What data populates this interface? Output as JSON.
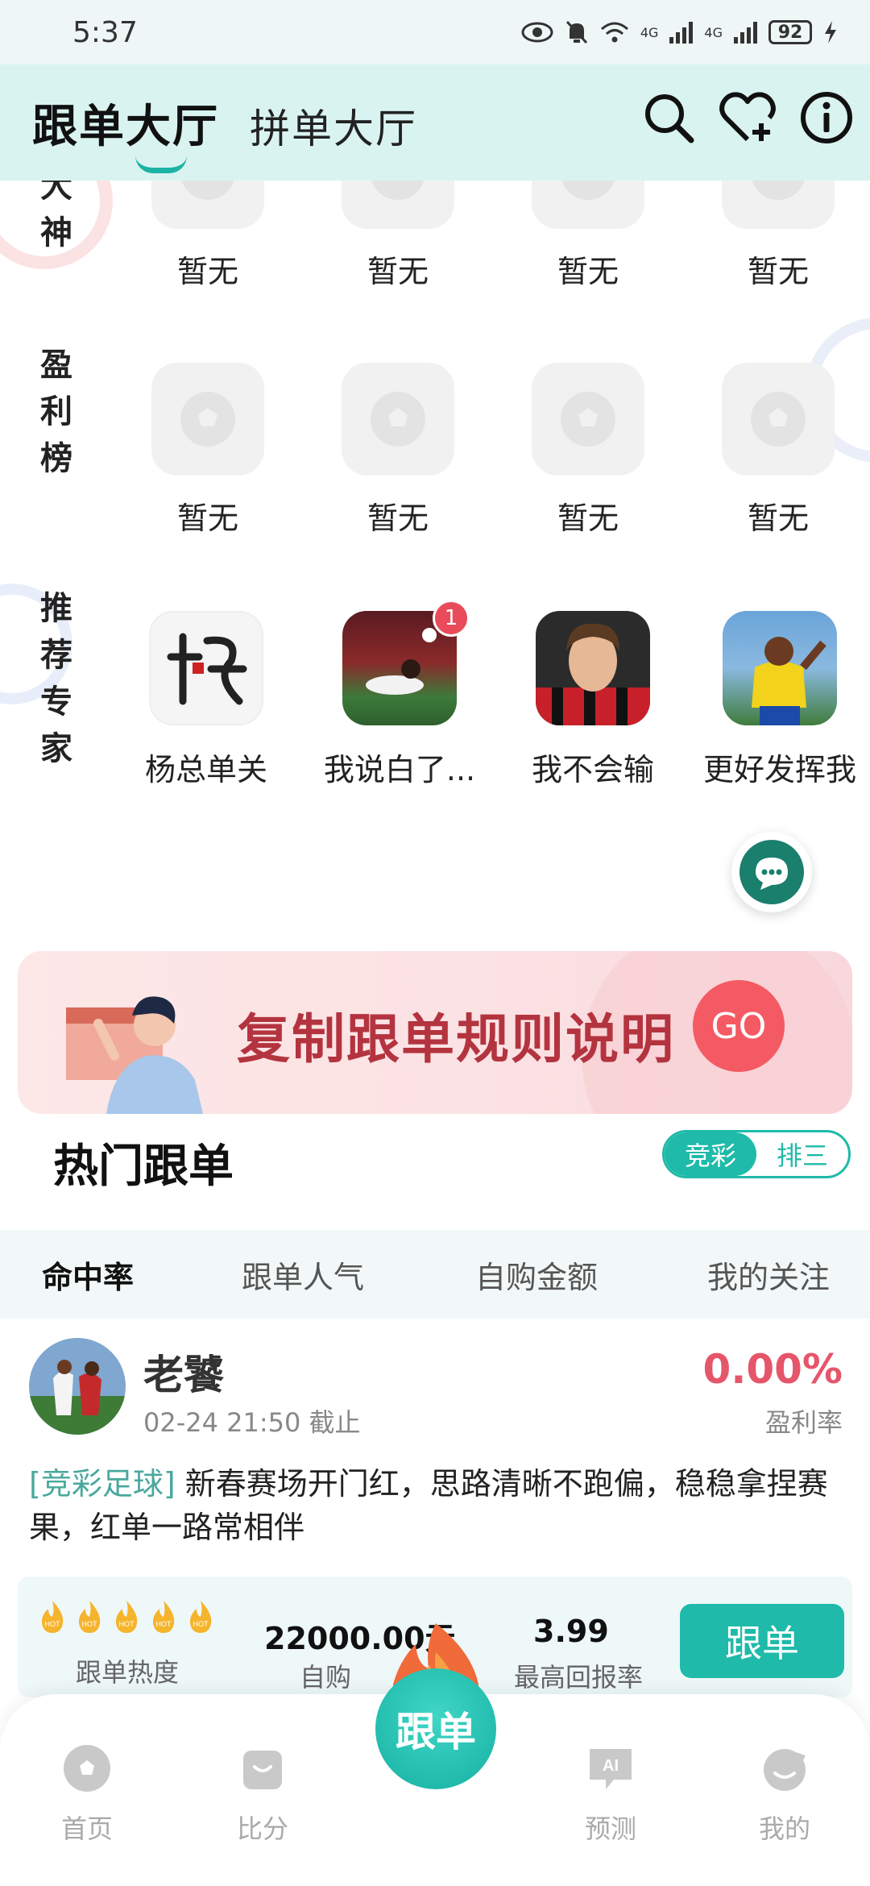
{
  "status_bar": {
    "time": "5:37",
    "battery": "92",
    "net1": "4G",
    "net2": "4G"
  },
  "header": {
    "tab_active": "跟单大厅",
    "tab_other": "拼单大厅"
  },
  "rankings": {
    "row1": {
      "label": "大神",
      "items": [
        "暂无",
        "暂无",
        "暂无",
        "暂无"
      ]
    },
    "row2": {
      "label": "盈利榜",
      "items": [
        "暂无",
        "暂无",
        "暂无",
        "暂无"
      ]
    },
    "experts": {
      "label": "推荐专家",
      "items": [
        {
          "name": "杨总单关"
        },
        {
          "name": "我说白了...",
          "badge": "1"
        },
        {
          "name": "我不会输"
        },
        {
          "name": "更好发挥我"
        }
      ]
    }
  },
  "banner": {
    "text": "复制跟单规则说明",
    "go": "GO"
  },
  "hot": {
    "title": "热门跟单",
    "segment": [
      "竞彩",
      "排三"
    ],
    "sort_tabs": [
      "命中率",
      "跟单人气",
      "自购金额",
      "我的关注"
    ]
  },
  "card": {
    "name": "老饕",
    "time": "02-24 21:50 截止",
    "rate": "0.00%",
    "rate_label": "盈利率",
    "tag": "[竞彩足球]",
    "desc": " 新春赛场开门红，思路清晰不跑偏，稳稳拿捏赛果，红单一路常相伴",
    "heat_label": "跟单热度",
    "amount": "22000.00元",
    "amount_label": "自购",
    "max_return": "3.99",
    "max_return_label": "最高回报率",
    "follow_btn": "跟单",
    "flame_text": "HOT"
  },
  "bottom_nav": {
    "items": [
      "首页",
      "比分",
      "预测",
      "我的"
    ],
    "center": "跟单",
    "ai_text": "AI"
  },
  "colors": {
    "accent": "#1fbaa9",
    "red": "#e5566a",
    "header_bg": "#d9f3f0"
  }
}
